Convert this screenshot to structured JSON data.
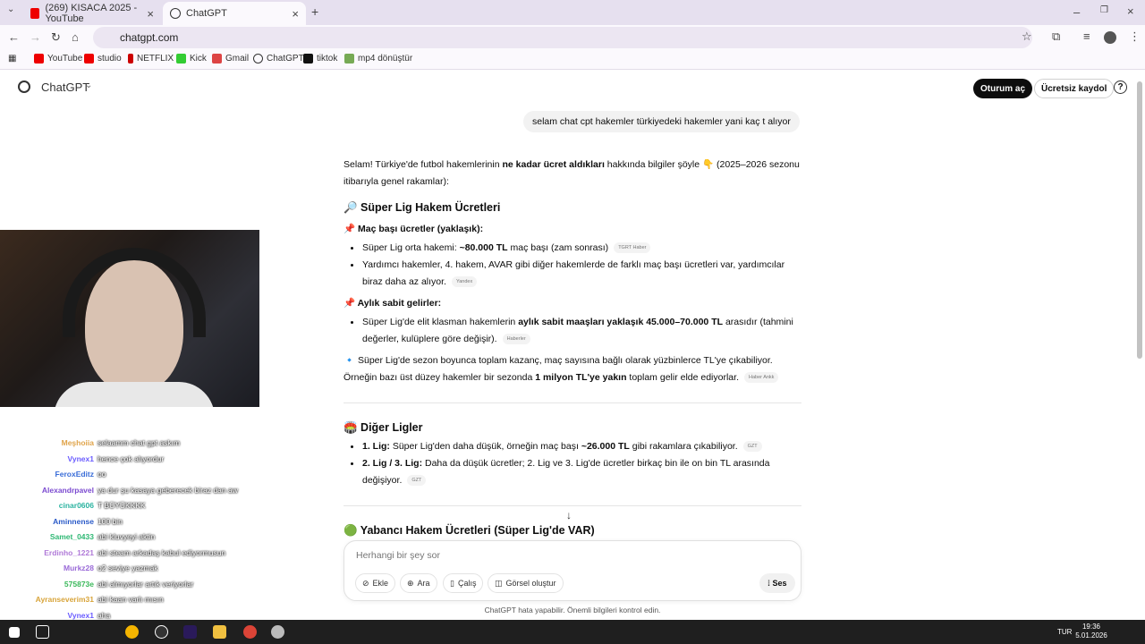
{
  "browser": {
    "tabs": [
      {
        "title": "(269) KISACA 2025 - YouTube",
        "active": false
      },
      {
        "title": "ChatGPT",
        "active": true
      }
    ],
    "url": "chatgpt.com",
    "bookmarks": [
      "YouTube",
      "studio",
      "NETFLIX",
      "Kick",
      "Gmail",
      "ChatGPT",
      "tiktok",
      "mp4 dönüştür"
    ]
  },
  "header": {
    "app_title": "ChatGPT",
    "login_label": "Oturum aç",
    "signup_label": "Ücretsiz kaydol",
    "help_label": "?"
  },
  "conversation": {
    "user_message": "selam chat cpt hakemler türkiyedeki hakemler yani kaç t alıyor",
    "intro_1": "Selam! Türkiye'de futbol hakemlerinin ",
    "intro_bold": "ne kadar ücret aldıkları",
    "intro_2": " hakkında bilgiler şöyle 👇 (2025–2026 sezonu",
    "intro_3": "itibarıyla genel rakamlar):",
    "section1_title": "🔎 Süper Lig Hakem Ücretleri",
    "match_fee_heading": "📌 Maç başı ücretler (yaklaşık):",
    "b1_pre": "Süper Lig orta hakemi: ",
    "b1_bold": "~80.000 TL",
    "b1_post": " maç başı (zam sonrası)",
    "b1_src": "TGRT Haber",
    "b2_line1": "Yardımcı hakemler, 4. hakem, AVAR gibi diğer hakemlerde de farklı maç başı ücretleri var, yardımcılar",
    "b2_line2": "biraz daha az alıyor.",
    "b2_src": "Yandex",
    "monthly_heading": "📌 Aylık sabit gelirler:",
    "b3_pre": "Süper Lig'de elit klasman hakemlerin ",
    "b3_bold": "aylık sabit maaşları yaklaşık 45.000–70.000 TL",
    "b3_post": " arasıdır (tahmini",
    "b3_line2": "değerler, kulüplere göre değişir).",
    "b3_src": "Haberler",
    "season_line1": "🔹 Süper Lig'de sezon boyunca toplam kazanç, maç sayısına bağlı olarak yüzbinlerce TL'ye çıkabiliyor.",
    "season_pre": "Örneğin bazı üst düzey hakemler bir sezonda ",
    "season_bold": "1 milyon TL'ye yakın",
    "season_post": " toplam gelir elde ediyorlar.",
    "season_src": "Haber Ankk",
    "section2_title": "🏟️ Diğer Ligler",
    "l1_bold": "1. Lig:",
    "l1_text": " Süper Lig'den daha düşük, örneğin maç başı ",
    "l1_bold2": "~26.000 TL",
    "l1_post": " gibi rakamlara çıkabiliyor.",
    "l1_src": "GZT",
    "l2_bold": "2. Lig / 3. Lig:",
    "l2_text": " Daha da düşük ücretler; 2. Lig ve 3. Lig'de ücretler birkaç bin ile on bin TL arasında",
    "l2_line2": "değişiyor.",
    "l2_src": "GZT",
    "section3_title": "🟢 Yabancı Hakem Ücretleri (Süper Lig'de VAR)"
  },
  "composer": {
    "placeholder": "Herhangi bir şey sor",
    "buttons": [
      "Ekle",
      "Ara",
      "Çalış",
      "Görsel oluştur"
    ],
    "voice_label": "Ses",
    "disclaimer": "ChatGPT hata yapabilir. Önemli bilgileri kontrol edin."
  },
  "stream_chat": [
    {
      "user": "Meşhoiia",
      "msg": "selaamm chat gpt askım",
      "color": "#e0a44a"
    },
    {
      "user": "Vynex1",
      "msg": "hence çok alıyordur",
      "color": "#6a5cff"
    },
    {
      "user": "FeroxEditz",
      "msg": "oo",
      "color": "#3a6dd8"
    },
    {
      "user": "Alexandrpavel",
      "msg": "ya dur şu kasaya geberecek biraz dan aw",
      "color": "#7b4ad0"
    },
    {
      "user": "cinar0606",
      "msg": "T BÜYÜKKKK",
      "color": "#2bb3a0"
    },
    {
      "user": "Aminnense",
      "msg": "100 bin",
      "color": "#2a5ac8"
    },
    {
      "user": "Samet_0433",
      "msg": "abi kluvyeyi aktin",
      "color": "#2fb874"
    },
    {
      "user": "Erdinho_1221",
      "msg": "abi steam arkadaş kabul ediyormusun",
      "color": "#b07ad8"
    },
    {
      "user": "Murkz28",
      "msg": "o2 seviye yazmak",
      "color": "#9a6ad8"
    },
    {
      "user": "575873e",
      "msg": "abi almıyorlar artık veriyorlar",
      "color": "#3ab85a"
    },
    {
      "user": "Ayranseverim31",
      "msg": "abi kaan varlı mısın",
      "color": "#d8a43a"
    },
    {
      "user": "Vynex1",
      "msg": "aha",
      "color": "#6a5cff"
    }
  ],
  "taskbar": {
    "lang": "TUR",
    "time": "19:36",
    "date": "5.01.2026"
  }
}
